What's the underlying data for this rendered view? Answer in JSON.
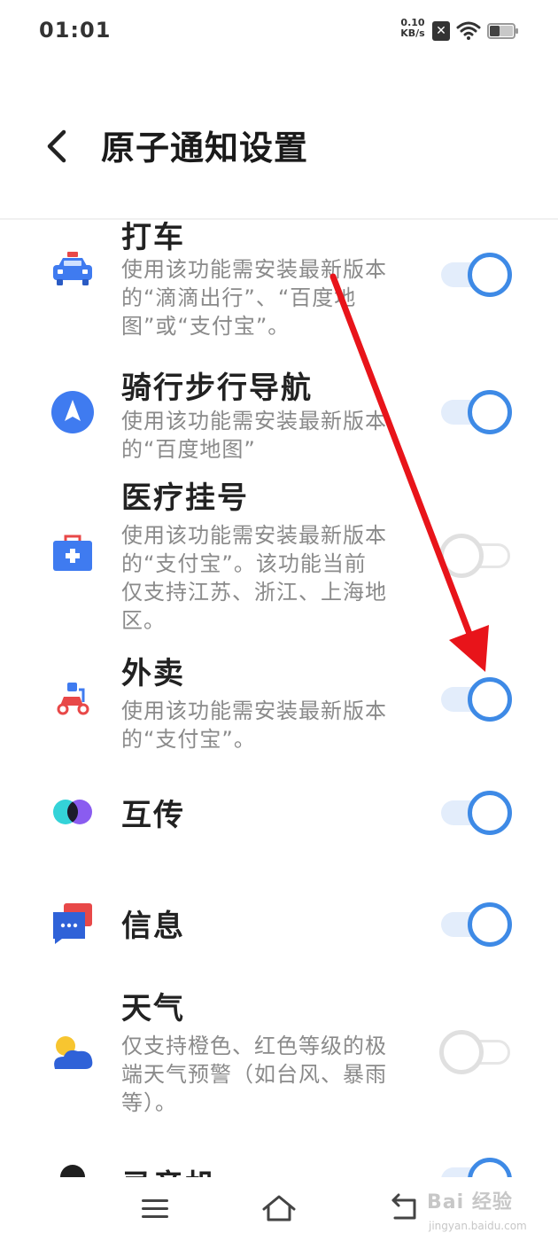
{
  "status_bar": {
    "time": "01:01",
    "net_speed_value": "0.10",
    "net_speed_unit": "KB/s",
    "sim_icon": "sim-error-icon",
    "wifi_icon": "wifi-icon",
    "battery_icon": "battery-icon"
  },
  "header": {
    "back_icon": "chevron-left-icon",
    "title": "原子通知设置"
  },
  "colors": {
    "toggle_on": "#3e8ae6",
    "toggle_on_track": "#e3edfb",
    "toggle_off": "#e0e0e0",
    "annotation_arrow": "#e8141a"
  },
  "settings": [
    {
      "icon": "taxi-icon",
      "title": "打车",
      "desc": "使用该功能需安装最新版本的“滴滴出行”、“百度地图”或“支付宝”。",
      "enabled": true
    },
    {
      "icon": "navigation-arrow-icon",
      "title": "骑行步行导航",
      "desc": "使用该功能需安装最新版本的“百度地图”",
      "enabled": true
    },
    {
      "icon": "medical-kit-icon",
      "title": "医疗挂号",
      "desc": "使用该功能需安装最新版本的“支付宝”。该功能当前仅支持江苏、浙江、上海地区。",
      "enabled": false
    },
    {
      "icon": "delivery-scooter-icon",
      "title": "外卖",
      "desc": "使用该功能需安装最新版本的“支付宝”。",
      "enabled": true
    },
    {
      "icon": "share-transfer-icon",
      "title": "互传",
      "desc": "",
      "enabled": true
    },
    {
      "icon": "message-icon",
      "title": "信息",
      "desc": "",
      "enabled": true
    },
    {
      "icon": "weather-icon",
      "title": "天气",
      "desc": "仅支持橙色、红色等级的极端天气预警（如台风、暴雨等）。",
      "enabled": false
    },
    {
      "icon": "recorder-icon",
      "title": "录音机",
      "desc": "",
      "enabled": true
    }
  ],
  "nav_bar": {
    "menu_icon": "menu-icon",
    "home_icon": "home-icon",
    "back_icon": "back-icon"
  },
  "watermark": {
    "main": "Bai  经验",
    "sub": "jingyan.baidu.com"
  }
}
